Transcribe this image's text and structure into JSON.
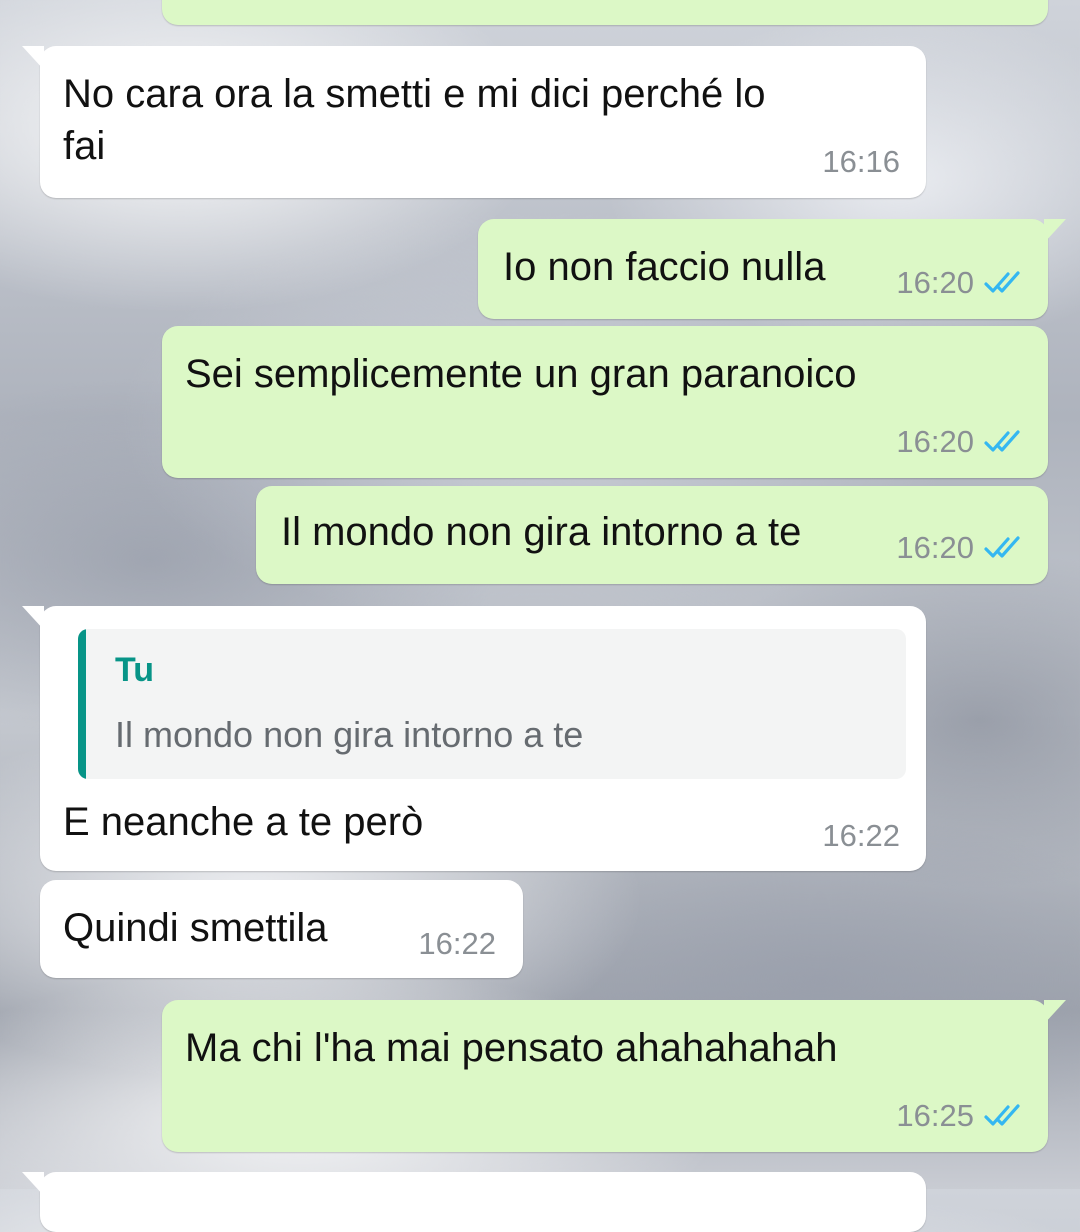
{
  "colors": {
    "incoming_bubble": "#ffffff",
    "outgoing_bubble": "#dcf8c6",
    "read_ticks": "#34b7f1",
    "quote_accent": "#079487",
    "timestamp": "#8a8f94"
  },
  "messages": [
    {
      "direction": "in",
      "text": "No cara ora la smetti e mi dici perché lo\nfai",
      "time": "16:16"
    },
    {
      "direction": "out",
      "text": "Io non faccio nulla",
      "time": "16:20",
      "status": "read-double-check-icon"
    },
    {
      "direction": "out",
      "text": "Sei semplicemente un gran paranoico",
      "time": "16:20",
      "status": "read-double-check-icon"
    },
    {
      "direction": "out",
      "text": "Il mondo non gira intorno a te",
      "time": "16:20",
      "status": "read-double-check-icon"
    },
    {
      "direction": "in",
      "reply": {
        "author": "Tu",
        "text": "Il mondo non gira intorno a te"
      },
      "text": "E neanche a te però",
      "time": "16:22"
    },
    {
      "direction": "in",
      "text": "Quindi smettila",
      "time": "16:22"
    },
    {
      "direction": "out",
      "text": "Ma chi l'ha mai pensato ahahahahah",
      "time": "16:25",
      "status": "read-double-check-icon"
    }
  ]
}
